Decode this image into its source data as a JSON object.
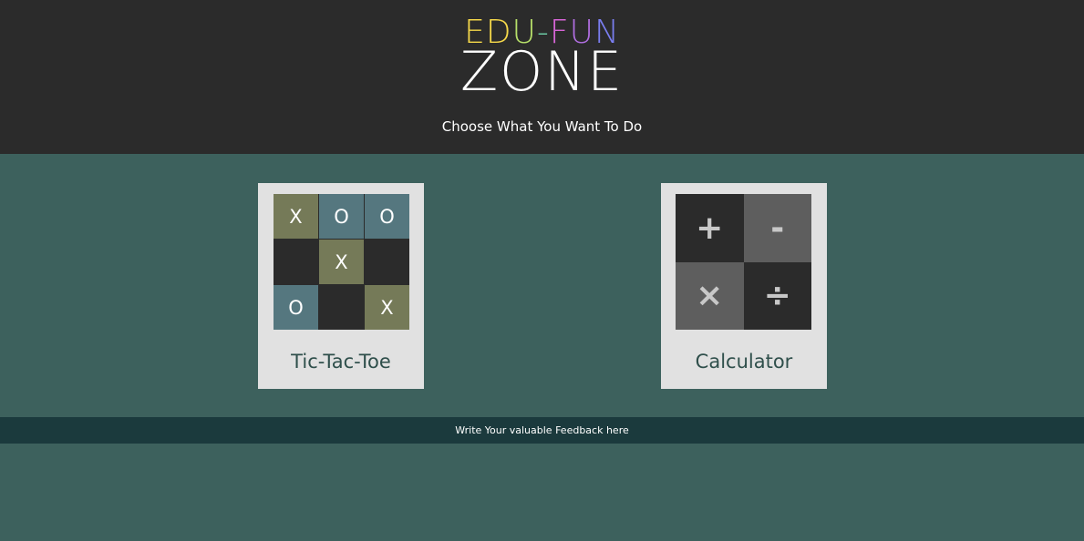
{
  "header": {
    "logo_top": [
      {
        "char": "E",
        "color": "#f5d84a"
      },
      {
        "char": "D",
        "color": "#f5d84a"
      },
      {
        "char": "U",
        "color": "#b7e06a"
      },
      {
        "char": "-",
        "color": "#6fd0a9"
      },
      {
        "char": "F",
        "color": "#d865d8"
      },
      {
        "char": "U",
        "color": "#b06ee0"
      },
      {
        "char": "N",
        "color": "#7a7ef0"
      }
    ],
    "logo_bottom": "ZONE",
    "subtitle": "Choose What You Want To Do"
  },
  "cards": {
    "tic_tac_toe": {
      "label": "Tic-Tac-Toe",
      "board": [
        {
          "mark": "X",
          "color": "#757a58"
        },
        {
          "mark": "O",
          "color": "#55777f"
        },
        {
          "mark": "O",
          "color": "#55777f"
        },
        {
          "mark": "",
          "color": "#2b2b2b"
        },
        {
          "mark": "X",
          "color": "#757a58"
        },
        {
          "mark": "",
          "color": "#2b2b2b"
        },
        {
          "mark": "O",
          "color": "#55777f"
        },
        {
          "mark": "",
          "color": "#2b2b2b"
        },
        {
          "mark": "X",
          "color": "#757a58"
        }
      ]
    },
    "calculator": {
      "label": "Calculator",
      "operators": [
        {
          "symbol": "+",
          "color": "#2b2b2b",
          "icon": "plus-icon"
        },
        {
          "symbol": "-",
          "color": "#5e5e5e",
          "icon": "minus-icon"
        },
        {
          "symbol": "×",
          "color": "#5e5e5e",
          "icon": "multiply-icon"
        },
        {
          "symbol": "÷",
          "color": "#2b2b2b",
          "icon": "divide-icon"
        }
      ]
    }
  },
  "footer": {
    "feedback_link": "Write Your valuable Feedback here"
  },
  "colors": {
    "header_bg": "#2b2b2b",
    "page_bg": "#3d615d",
    "card_bg": "#e1e1e1",
    "feedback_bg": "#1b3a3d"
  }
}
